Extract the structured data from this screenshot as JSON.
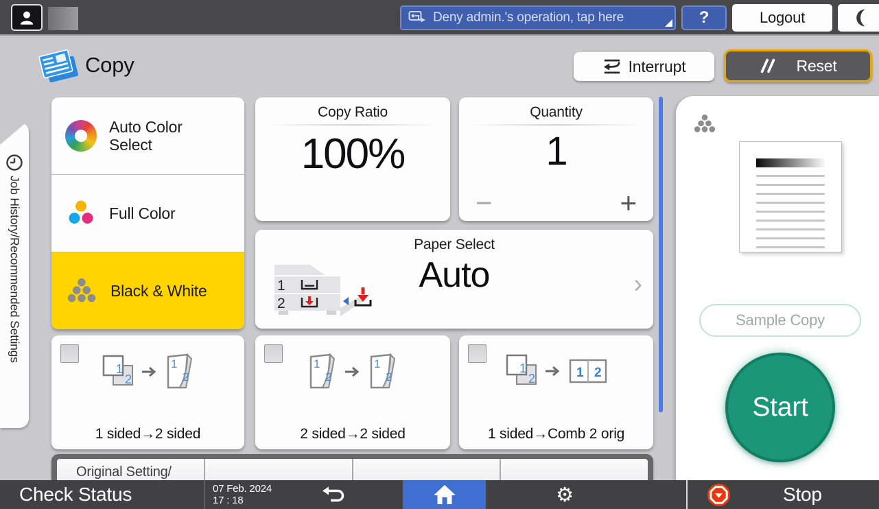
{
  "topbar": {
    "deny_banner": "Deny admin.'s operation, tap here",
    "help": "?",
    "logout": "Logout"
  },
  "header": {
    "app_title": "Copy",
    "interrupt": "Interrupt",
    "reset": "Reset"
  },
  "side_tab": {
    "label": "Job History/Recommended Settings"
  },
  "color_modes": {
    "auto": "Auto Color Select",
    "full": "Full Color",
    "bw": "Black & White"
  },
  "copy_ratio": {
    "label": "Copy Ratio",
    "value": "100%"
  },
  "quantity": {
    "label": "Quantity",
    "value": "1",
    "minus": "−",
    "plus": "+"
  },
  "paper_select": {
    "label": "Paper Select",
    "value": "Auto",
    "chevron": "›",
    "tray1": "1",
    "tray2": "2"
  },
  "duplex": {
    "n1": "1",
    "n2": "2",
    "options": [
      {
        "label": "1 sided→2 sided"
      },
      {
        "label": "2 sided→2 sided"
      },
      {
        "label": "1 sided→Comb 2 orig"
      }
    ]
  },
  "more_row": {
    "label": "Original Setting/"
  },
  "right_panel": {
    "sample_copy": "Sample Copy",
    "start": "Start"
  },
  "bottom_bar": {
    "check_status": "Check Status",
    "date": "07 Feb. 2024",
    "time": "17 : 18",
    "gear": "⚙",
    "stop": "Stop"
  },
  "colors": {
    "selected_yellow": "#ffd400",
    "reset_border_yellow": "#eca600",
    "banner_blue": "#3f5fae",
    "home_blue": "#3f6fd1",
    "start_green": "#1b9679",
    "stop_red": "#e8380d",
    "scrollbar_blue": "#4b7ae6"
  }
}
